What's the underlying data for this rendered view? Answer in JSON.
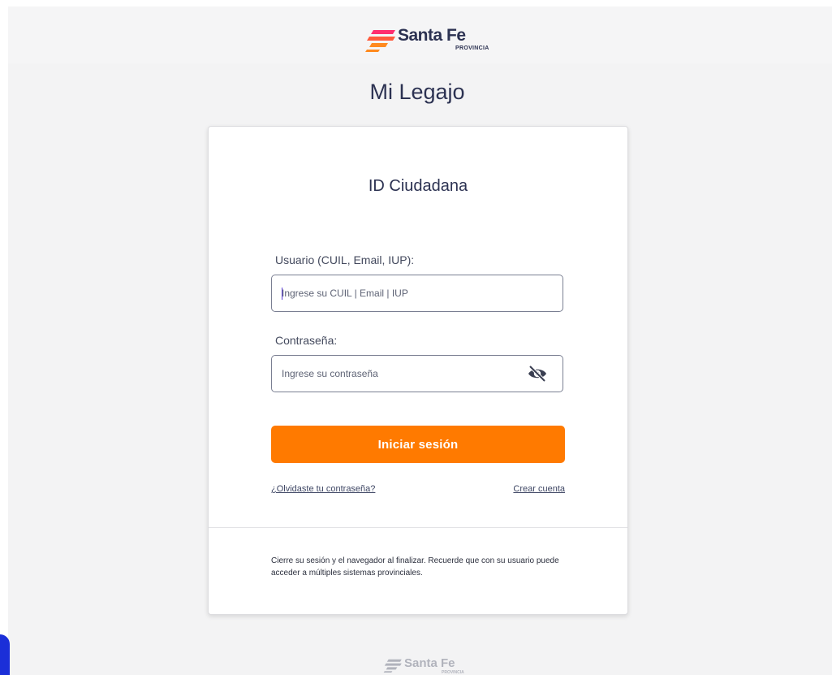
{
  "brand": {
    "name": "Santa Fe",
    "subtitle": "PROVINCIA",
    "colors": {
      "mark_top": "#ff2d6f",
      "mark_mid": "#ff5a3c",
      "mark_bottom": "#ff8a1f",
      "text": "#2c3252"
    }
  },
  "app": {
    "title": "Mi Legajo"
  },
  "login_card": {
    "title": "ID Ciudadana",
    "username": {
      "label": "Usuario (CUIL, Email, IUP):",
      "placeholder": "Ingrese su CUIL | Email | IUP",
      "value": ""
    },
    "password": {
      "label": "Contraseña:",
      "placeholder": "Ingrese su contraseña",
      "value": "",
      "toggle_icon": "eye-off-icon"
    },
    "submit_label": "Iniciar sesión",
    "forgot_link": "¿Olvidaste tu contraseña?",
    "create_link": "Crear cuenta",
    "notice": "Cierre su sesión y el navegador al finalizar. Recuerde que con su usuario puede acceder a múltiples sistemas provinciales."
  },
  "footer_brand": {
    "name": "Santa Fe",
    "subtitle": "PROVINCIA"
  },
  "theme": {
    "accent": "#ff7a00",
    "background": "#f3f3f4",
    "card": "#ffffff",
    "corner_blue": "#1b2fd8"
  }
}
